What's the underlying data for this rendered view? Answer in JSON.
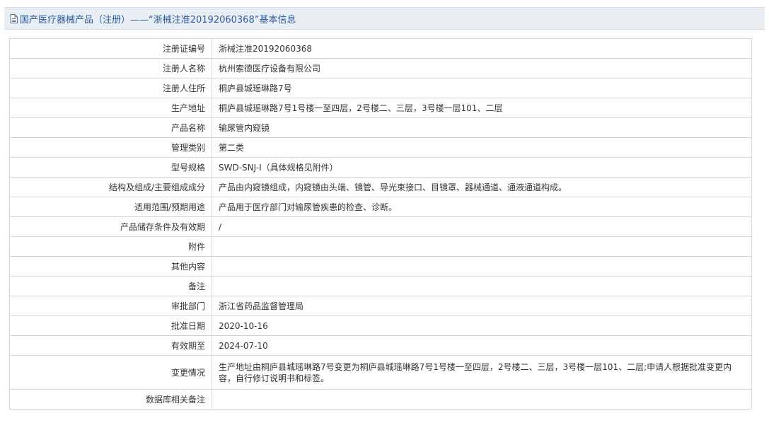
{
  "header": {
    "title": "国产医疗器械产品（注册）——“浙械注准20192060368”基本信息"
  },
  "rows": [
    {
      "label": "注册证编号",
      "value": "浙械注准20192060368"
    },
    {
      "label": "注册人名称",
      "value": "杭州索德医疗设备有限公司"
    },
    {
      "label": "注册人住所",
      "value": "桐庐县城瑶琳路7号"
    },
    {
      "label": "生产地址",
      "value": "桐庐县城瑶琳路7号1号楼一至四层，2号楼二、三层，3号楼一层101、二层"
    },
    {
      "label": "产品名称",
      "value": "输尿管内窥镜"
    },
    {
      "label": "管理类别",
      "value": "第二类"
    },
    {
      "label": "型号规格",
      "value": "SWD-SNJ-Ⅰ（具体规格见附件）"
    },
    {
      "label": "结构及组成/主要组成成分",
      "value": "产品由内窥镜组成，内窥镜由头端、镜管、导光束接口、目镜罩、器械通道、通液通道构成。"
    },
    {
      "label": "适用范围/预期用途",
      "value": "产品用于医疗部门对输尿管疾患的检查、诊断。"
    },
    {
      "label": "产品储存条件及有效期",
      "value": "/"
    },
    {
      "label": "附件",
      "value": ""
    },
    {
      "label": "其他内容",
      "value": ""
    },
    {
      "label": "备注",
      "value": ""
    },
    {
      "label": "审批部门",
      "value": "浙江省药品监督管理局"
    },
    {
      "label": "批准日期",
      "value": "2020-10-16"
    },
    {
      "label": "有效期至",
      "value": "2024-07-10"
    },
    {
      "label": "变更情况",
      "value": "生产地址由桐庐县城瑶琳路7号变更为桐庐县城瑶琳路7号1号楼一至四层，2号楼二、三层，3号楼一层101、二层;申请人根据批准变更内容，自行修订说明书和标签。"
    },
    {
      "label": "数据库相关备注",
      "value": ""
    }
  ],
  "icons": {
    "title_icon": "document-icon"
  }
}
